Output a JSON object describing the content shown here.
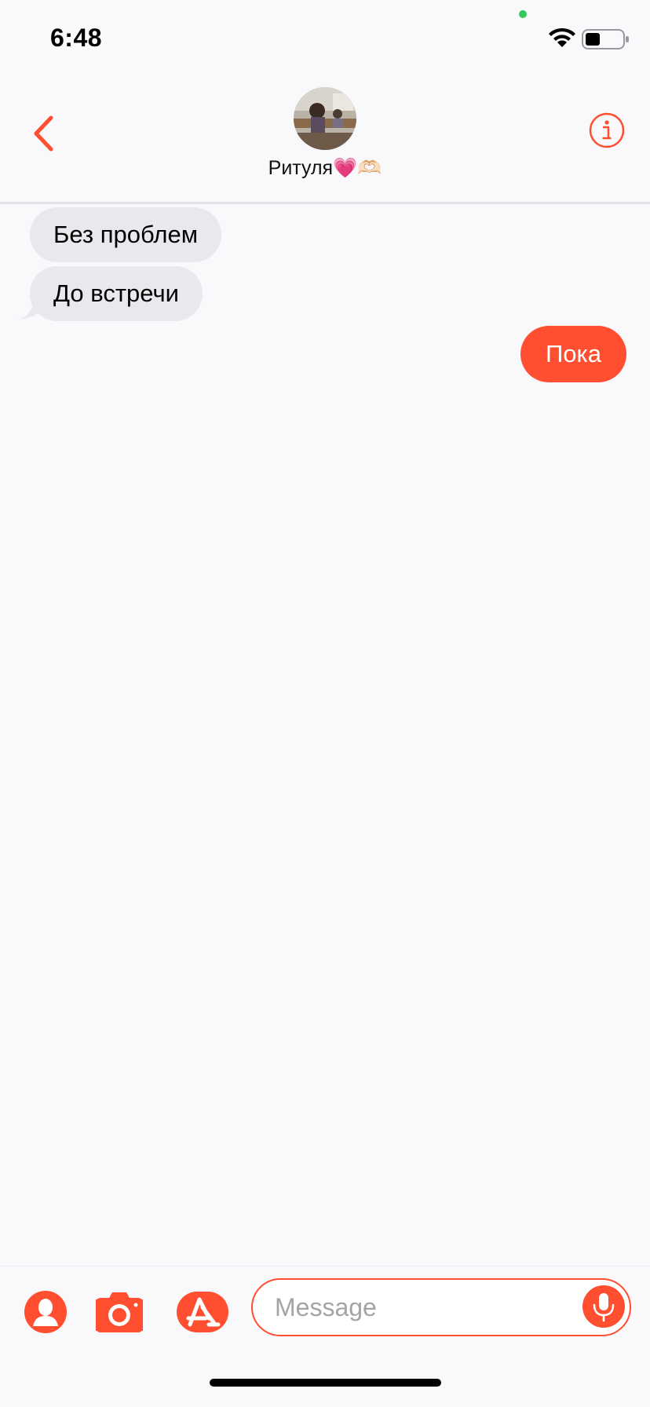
{
  "status_bar": {
    "time": "6:48",
    "wifi_icon": "wifi-icon",
    "battery_icon": "battery-icon"
  },
  "header": {
    "back_icon": "chevron-left-icon",
    "contact_name": "Ритуля💗🫶🏻",
    "info_icon": "info-icon"
  },
  "messages": [
    {
      "direction": "incoming",
      "text": "Без проблем"
    },
    {
      "direction": "incoming",
      "text": "До встречи"
    },
    {
      "direction": "outgoing",
      "text": "Пока"
    }
  ],
  "composer": {
    "placeholder": "Message",
    "value": "",
    "tools": [
      "contact-icon",
      "camera-icon",
      "app-store-icon"
    ],
    "mic_icon": "microphone-icon"
  },
  "colors": {
    "accent": "#ff4f30",
    "incoming_bubble": "#e9e8ed",
    "background": "#f9f8fb"
  }
}
